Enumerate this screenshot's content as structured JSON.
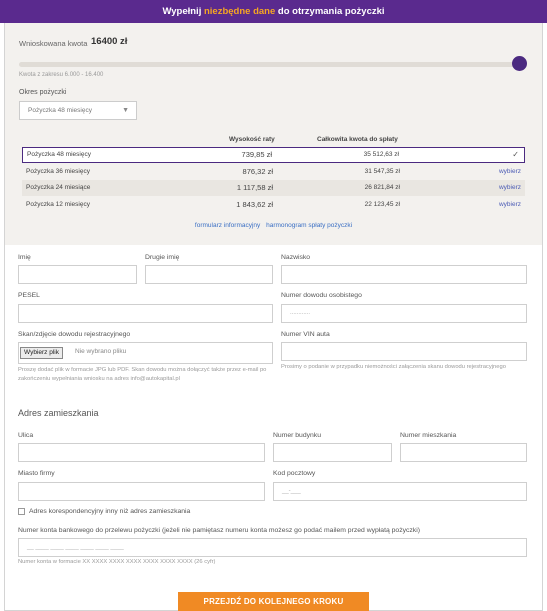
{
  "header": {
    "prefix": "Wypełnij ",
    "highlight": "niezbędne dane",
    "suffix": " do otrzymania pożyczki"
  },
  "loan": {
    "amount_label": "Wnioskowana kwota",
    "amount_value": "16400 zł",
    "slider_level": 1.0,
    "range_note": "Kwota z zakresu 6.000 - 16.400",
    "period_label": "Okres pożyczki",
    "period_selected": "Pożyczka 48 miesięcy"
  },
  "table": {
    "headers": [
      "Wysokość raty",
      "Całkowita kwota do spłaty"
    ],
    "rows": [
      {
        "name": "Pożyczka 48 miesięcy",
        "rate": "739,85 zł",
        "total": "35 512,63 zł",
        "action": "",
        "selected": true
      },
      {
        "name": "Pożyczka 36 miesięcy",
        "rate": "876,32 zł",
        "total": "31 547,35 zł",
        "action": "wybierz"
      },
      {
        "name": "Pożyczka 24 miesiące",
        "rate": "1 117,58 zł",
        "total": "26 821,84 zł",
        "action": "wybierz"
      },
      {
        "name": "Pożyczka 12 miesięcy",
        "rate": "1 843,62 zł",
        "total": "22 123,45 zł",
        "action": "wybierz"
      }
    ],
    "check_icon": "✓",
    "link_form": "formularz informacyjny",
    "link_schedule": "harmonogram spłaty pożyczki"
  },
  "form": {
    "first_name": "Imię",
    "second_name": "Drugie imię",
    "last_name": "Nazwisko",
    "pesel": "PESEL",
    "id_number": "Numer dowodu osobistego",
    "id_placeholder": "............",
    "scan_label": "Skan/zdjęcie dowodu rejestracyjnego",
    "file_button": "Wybierz plik",
    "file_none": "Nie wybrano pliku",
    "scan_note": "Proszę dodać plik w formacie JPG lub PDF. Skan dowodu można dołączyć także przez e-mail po zakończeniu wypełniania wniosku na adres info@autokapital.pl",
    "vin_label": "Numer VIN auta",
    "vin_note": "Prosimy o podanie w przypadku niemożności załączenia skanu dowodu rejestracyjnego"
  },
  "address": {
    "title": "Adres zamieszkania",
    "street": "Ulica",
    "building": "Numer budynku",
    "apartment": "Numer mieszkania",
    "city": "Miasto firmy",
    "postal": "Kod pocztowy",
    "postal_placeholder": "__-___",
    "corr_label": "Adres korespondencyjny inny niż adres zamieszkania",
    "bank_label": "Numer konta bankowego do przelewu pożyczki (jeżeli nie pamiętasz numeru konta możesz go podać mailem przed wypłatą pożyczki)",
    "bank_placeholder": "__ ____ ____ ____ ____ ____ ____",
    "bank_note": "Numer konta w formacie XX XXXX XXXX XXXX XXXX XXXX XXXX (26 cyfr)"
  },
  "cta": {
    "label": "PRZEJDŹ DO KOLEJNEGO KROKU"
  },
  "colors": {
    "brand_purple": "#5a2a8e",
    "accent_orange": "#f08a24",
    "link_blue": "#3a6fc4"
  }
}
